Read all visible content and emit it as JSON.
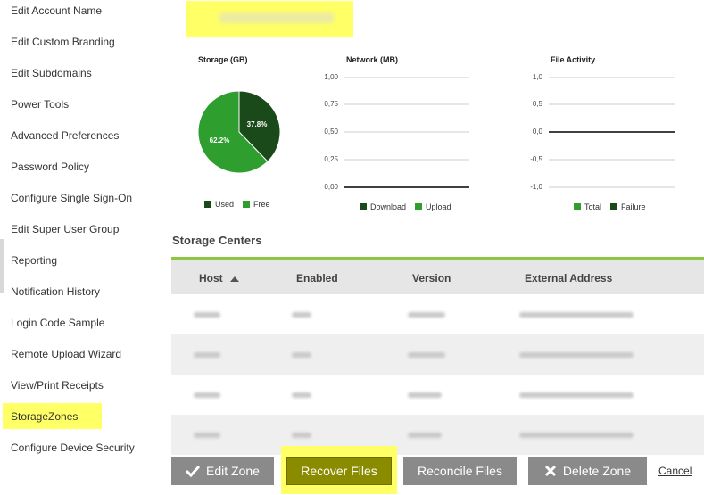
{
  "sidebar": {
    "items": [
      {
        "label": "Edit Account Name"
      },
      {
        "label": "Edit Custom Branding"
      },
      {
        "label": "Edit Subdomains"
      },
      {
        "label": "Power Tools"
      },
      {
        "label": "Advanced Preferences"
      },
      {
        "label": "Password Policy"
      },
      {
        "label": "Configure Single Sign-On"
      },
      {
        "label": "Edit Super User Group"
      },
      {
        "label": "Reporting"
      },
      {
        "label": "Notification History"
      },
      {
        "label": "Login Code Sample"
      },
      {
        "label": "Remote Upload Wizard"
      },
      {
        "label": "View/Print Receipts"
      },
      {
        "label": "StorageZones"
      },
      {
        "label": "Configure Device Security"
      }
    ]
  },
  "colors": {
    "highlight": "#ffff66",
    "dark_green": "#1a4a1a",
    "light_green": "#2e9e2e",
    "accent_green": "#8dc63f",
    "button_gray": "#8a8a8a",
    "recover_olive": "#8b8b00"
  },
  "charts": {
    "storage": {
      "title": "Storage (GB)",
      "slices": [
        {
          "label": "37.8%"
        },
        {
          "label": "62.2%"
        }
      ],
      "legend": [
        "Used",
        "Free"
      ]
    },
    "network": {
      "title": "Network (MB)",
      "ticks": [
        "1,00",
        "0,75",
        "0,50",
        "0,25",
        "0,00"
      ],
      "legend": [
        "Download",
        "Upload"
      ]
    },
    "activity": {
      "title": "File Activity",
      "ticks": [
        "1,0",
        "0,5",
        "0,0",
        "-0,5",
        "-1,0"
      ],
      "legend": [
        "Total",
        "Failure"
      ]
    }
  },
  "chart_data": [
    {
      "type": "pie",
      "title": "Storage (GB)",
      "categories": [
        "Used",
        "Free"
      ],
      "values": [
        37.8,
        62.2
      ],
      "colors": [
        "#1a4a1a",
        "#2e9e2e"
      ]
    },
    {
      "type": "line",
      "title": "Network (MB)",
      "ylim": [
        0,
        1
      ],
      "series": [
        {
          "name": "Download",
          "values": []
        },
        {
          "name": "Upload",
          "values": []
        }
      ]
    },
    {
      "type": "line",
      "title": "File Activity",
      "ylim": [
        -1,
        1
      ],
      "series": [
        {
          "name": "Total",
          "values": []
        },
        {
          "name": "Failure",
          "values": []
        }
      ]
    }
  ],
  "storage_centers": {
    "title": "Storage Centers",
    "columns": [
      "Host",
      "Enabled",
      "Version",
      "External Address"
    ],
    "sort_icon": "sort-asc-icon"
  },
  "buttons": {
    "edit": "Edit Zone",
    "recover": "Recover Files",
    "reconcile": "Reconcile Files",
    "delete": "Delete Zone",
    "cancel": "Cancel"
  },
  "icons": {
    "edit": "check-icon",
    "delete": "close-icon"
  }
}
